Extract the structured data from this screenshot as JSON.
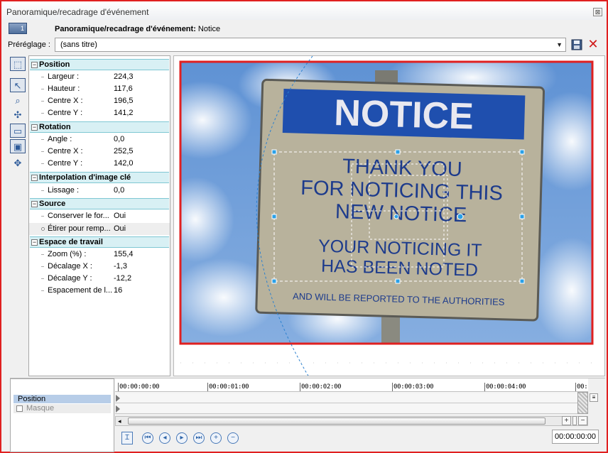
{
  "window": {
    "title": "Panoramique/recadrage d'événement",
    "close_glyph": "⊠"
  },
  "header": {
    "event_button_label": "1",
    "label": "Panoramique/recadrage d'événement:",
    "event_name": "Notice"
  },
  "preset": {
    "label": "Préréglage :",
    "value": "(sans titre)",
    "save_icon": "save-icon",
    "delete_icon": "delete-icon"
  },
  "tools": [
    "normal-edit-icon",
    "select-icon",
    "zoom-icon",
    "move-anchor-icon",
    "sync-cursor-icon",
    "fit-frame-icon",
    "move-freely-icon"
  ],
  "properties": {
    "position": {
      "label": "Position",
      "rows": [
        {
          "name": "Largeur :",
          "value": "224,3"
        },
        {
          "name": "Hauteur :",
          "value": "117,6"
        },
        {
          "name": "Centre X :",
          "value": "196,5"
        },
        {
          "name": "Centre Y :",
          "value": "141,2"
        }
      ]
    },
    "rotation": {
      "label": "Rotation",
      "rows": [
        {
          "name": "Angle :",
          "value": "0,0"
        },
        {
          "name": "Centre X :",
          "value": "252,5"
        },
        {
          "name": "Centre Y :",
          "value": "142,0"
        }
      ]
    },
    "interpolation": {
      "label": "Interpolation d'image clé",
      "rows": [
        {
          "name": "Lissage :",
          "value": "0,0"
        }
      ]
    },
    "source": {
      "label": "Source",
      "rows": [
        {
          "name": "Conserver le for...",
          "value": "Oui"
        },
        {
          "name": "Étirer pour remp...",
          "value": "Oui"
        }
      ]
    },
    "workspace": {
      "label": "Espace de travail",
      "rows": [
        {
          "name": "Zoom (%) :",
          "value": "155,4"
        },
        {
          "name": "Décalage X :",
          "value": "-1,3"
        },
        {
          "name": "Décalage Y :",
          "value": "-12,2"
        },
        {
          "name": "Espacement de l...",
          "value": "16"
        }
      ]
    }
  },
  "preview": {
    "sign": {
      "header": "NOTICE",
      "line1": "THANK YOU",
      "line2": "FOR NOTICING THIS",
      "line3": "NEW NOTICE",
      "line4": "YOUR NOTICING IT",
      "line5": "HAS BEEN NOTED",
      "footer": "AND WILL BE REPORTED TO THE AUTHORITIES"
    },
    "colors": {
      "frame": "#e02020",
      "sign_blue": "#1f4fae",
      "sky": "#6f9dd8",
      "selection": "#2aa0e8"
    }
  },
  "timeline": {
    "tracks": [
      {
        "label": "Position"
      },
      {
        "label": "Masque"
      }
    ],
    "ruler": [
      "00:00:00:00",
      "00:00:01:00",
      "00:00:02:00",
      "00:00:03:00",
      "00:00:04:00",
      "00:"
    ],
    "current_time": "00:00:00:00"
  }
}
